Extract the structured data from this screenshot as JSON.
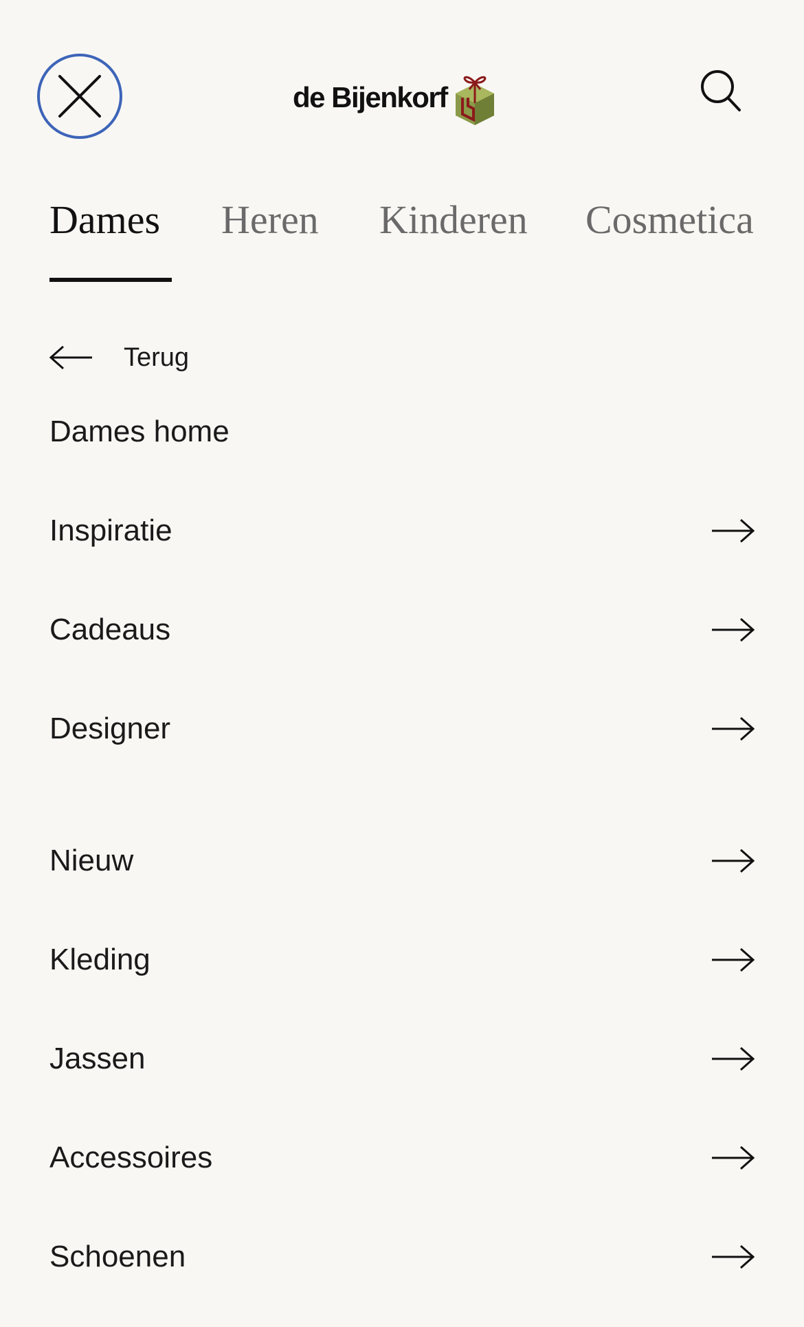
{
  "header": {
    "logo_text": "de Bijenkorf",
    "close_icon": "close-icon",
    "search_icon": "search-icon",
    "accent_color": "#3d64b8"
  },
  "tabs": [
    {
      "label": "Dames",
      "active": true
    },
    {
      "label": "Heren",
      "active": false
    },
    {
      "label": "Kinderen",
      "active": false
    },
    {
      "label": "Cosmetica",
      "active": false
    }
  ],
  "back": {
    "label": "Terug",
    "icon": "arrow-left-icon"
  },
  "menu": {
    "home_label": "Dames home",
    "items": [
      {
        "label": "Inspiratie"
      },
      {
        "label": "Cadeaus"
      },
      {
        "label": "Designer"
      },
      {
        "label": "Nieuw"
      },
      {
        "label": "Kleding"
      },
      {
        "label": "Jassen"
      },
      {
        "label": "Accessoires"
      },
      {
        "label": "Schoenen"
      }
    ],
    "arrow_icon": "arrow-right-icon"
  }
}
